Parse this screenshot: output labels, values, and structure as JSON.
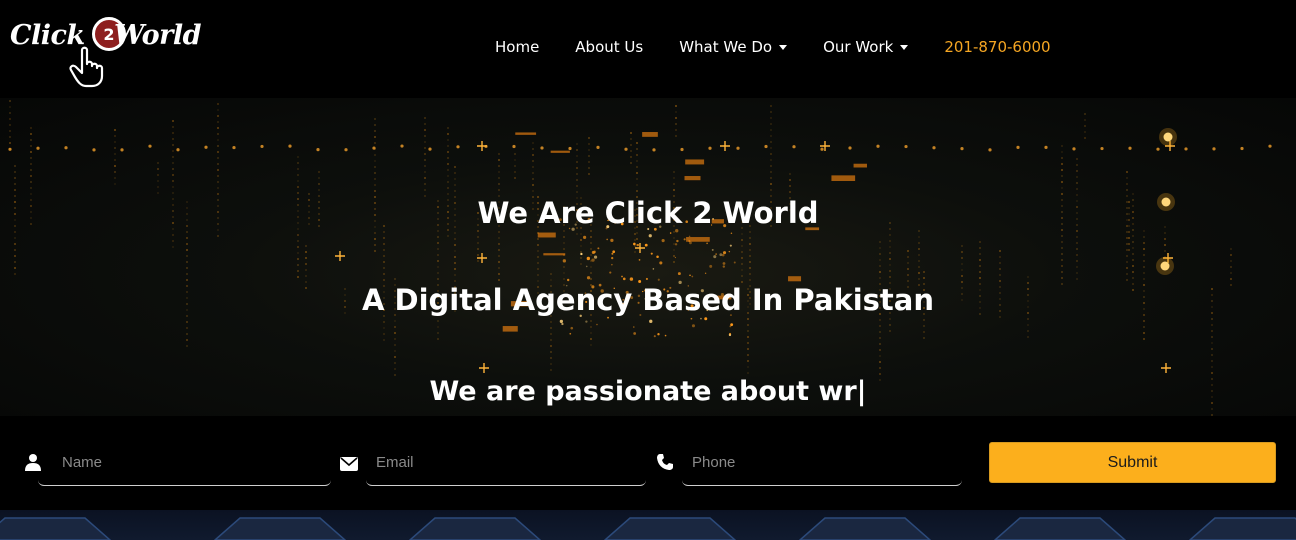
{
  "logo": {
    "text_left": "Click",
    "text_mid": "2",
    "text_right": "World"
  },
  "nav": {
    "home": "Home",
    "about": "About Us",
    "what_we_do": "What We Do",
    "our_work": "Our Work",
    "phone": "201-870-6000"
  },
  "hero": {
    "title": "We Are Click 2 World",
    "subtitle": "A Digital Agency Based In Pakistan",
    "typing": "We are passionate about wr|"
  },
  "form": {
    "name_placeholder": "Name",
    "email_placeholder": "Email",
    "phone_placeholder": "Phone",
    "submit_label": "Submit"
  },
  "colors": {
    "accent": "#fcaf1c",
    "phone_link": "#f5a623",
    "background": "#000000"
  },
  "icons": [
    "hand-pointer-icon",
    "user-icon",
    "envelope-icon",
    "phone-icon",
    "chevron-down-icon"
  ]
}
